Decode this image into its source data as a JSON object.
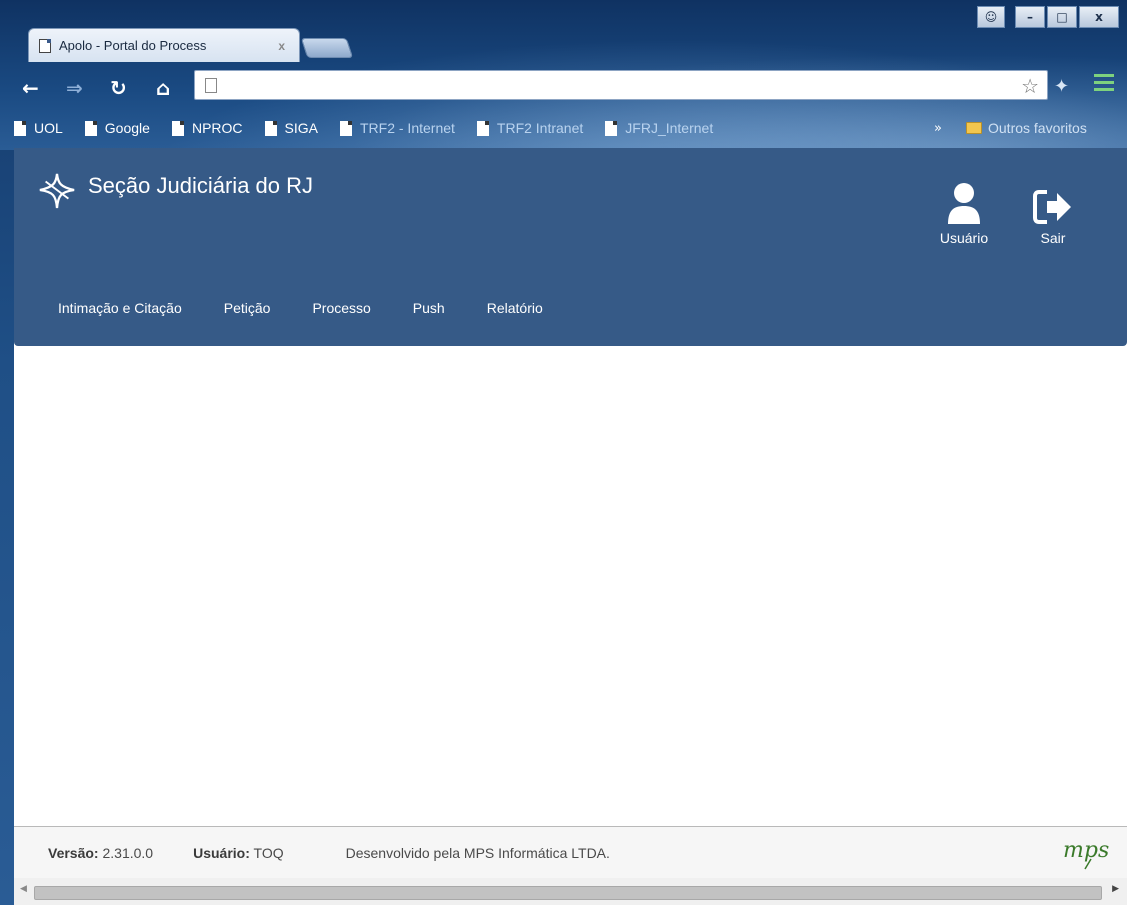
{
  "browser": {
    "tab_title": "Apolo - Portal do Process",
    "tab_close": "x",
    "window_controls": {
      "user": "☺",
      "minimize": "–",
      "maximize": "□",
      "close": "x"
    },
    "address_bar": {
      "value": "",
      "placeholder": ""
    },
    "bookmarks": [
      {
        "label": "UOL",
        "dim": false
      },
      {
        "label": "Google",
        "dim": false
      },
      {
        "label": "NPROC",
        "dim": false
      },
      {
        "label": "SIGA",
        "dim": false
      },
      {
        "label": "TRF2 - Internet",
        "dim": true
      },
      {
        "label": "TRF2 Intranet",
        "dim": true
      },
      {
        "label": "JFRJ_Internet",
        "dim": true
      }
    ],
    "bookmarks_more": "»",
    "other_bookmarks": "Outros favoritos"
  },
  "app": {
    "title": "Seção Judiciária do RJ",
    "user_label": "Usuário",
    "logout_label": "Sair",
    "nav": [
      "Intimação e Citação",
      "Petição",
      "Processo",
      "Push",
      "Relatório"
    ]
  },
  "footer": {
    "version_label": "Versão:",
    "version_value": "2.31.0.0",
    "user_label": "Usuário:",
    "user_value": "TOQ",
    "developer_text": "Desenvolvido pela MPS Informática LTDA.",
    "logo_text": "mps"
  },
  "colors": {
    "header_bg": "#365a87",
    "logo_green": "#3a7a2a"
  }
}
